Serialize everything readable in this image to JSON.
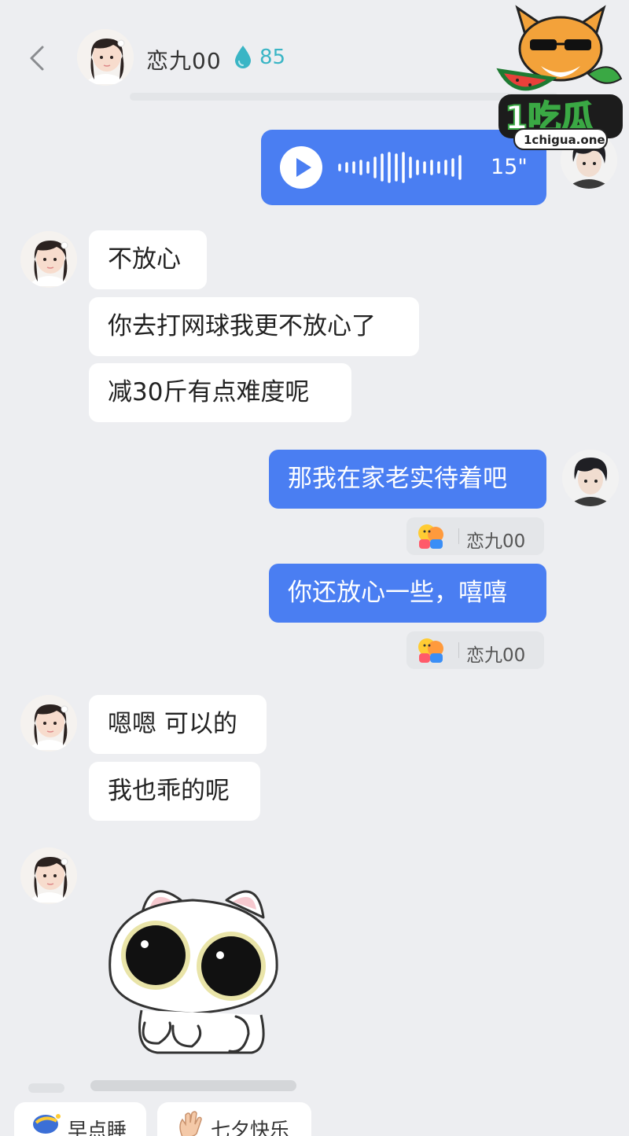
{
  "header": {
    "contact_name": "恋九00",
    "intimacy_count": "85",
    "back_icon": "chevron-left-icon",
    "drop_icon": "water-drop-icon"
  },
  "voice_message": {
    "duration": "15\"",
    "play_icon": "play-icon"
  },
  "messages": [
    {
      "side": "in",
      "text": "不放心"
    },
    {
      "side": "in",
      "text": "你去打网球我更不放心了"
    },
    {
      "side": "in",
      "text": "减30斤有点难度呢"
    },
    {
      "side": "out",
      "text": "那我在家老实待着吧"
    },
    {
      "side": "out",
      "text": "你还放心一些，嘻嘻"
    },
    {
      "side": "in",
      "text": "嗯嗯 可以的"
    },
    {
      "side": "in",
      "text": "我也乖的呢"
    }
  ],
  "reactions": [
    {
      "emoji": "hug-emoji-icon",
      "name": "恋九00"
    },
    {
      "emoji": "hug-emoji-icon",
      "name": "恋九00"
    }
  ],
  "quick_replies": [
    {
      "icon": "moon-icon",
      "label": "早点睡"
    },
    {
      "icon": "wave-hand-icon",
      "label": "七夕快乐"
    }
  ],
  "watermark": {
    "brand": "1吃瓜",
    "site": "1chigua.one"
  },
  "colors": {
    "background": "#edeef1",
    "outgoing_bubble": "#4a7ef2",
    "incoming_bubble": "#ffffff",
    "intimacy": "#3ab5c5"
  }
}
